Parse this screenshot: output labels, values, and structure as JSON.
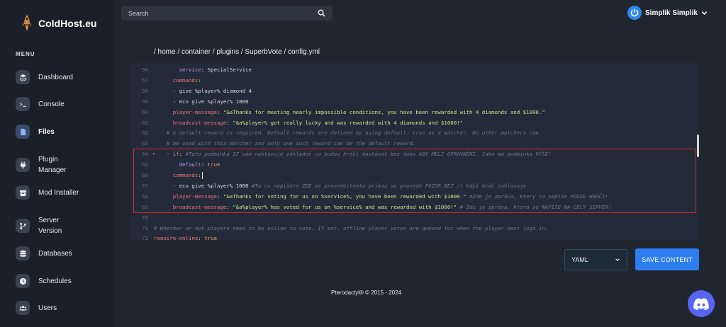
{
  "brand": {
    "name": "ColdHost.eu"
  },
  "sidebar": {
    "menu_heading": "MENU",
    "items": [
      {
        "label": "Dashboard",
        "icon": "layers-icon"
      },
      {
        "label": "Console",
        "icon": "terminal-icon"
      },
      {
        "label": "Files",
        "icon": "file-icon",
        "active": true
      },
      {
        "label": "Plugin\nManager",
        "icon": "plug-icon"
      },
      {
        "label": "Mod Installer",
        "icon": "box-icon"
      },
      {
        "label": "Server\nVersion",
        "icon": "branch-icon"
      },
      {
        "label": "Databases",
        "icon": "database-icon"
      },
      {
        "label": "Schedules",
        "icon": "clock-icon"
      },
      {
        "label": "Users",
        "icon": "users-icon"
      }
    ]
  },
  "search": {
    "placeholder": "Search"
  },
  "user": {
    "name": "Simplik Simplik"
  },
  "breadcrumb": "/ home / container / plugins / SuperbVote / config.yml",
  "editor": {
    "lines": [
      {
        "n": "56",
        "segs": [
          [
            "t",
            "        "
          ],
          [
            "kv",
            "service"
          ],
          [
            "t",
            ": SpecialService"
          ]
        ]
      },
      {
        "n": "57",
        "segs": [
          [
            "t",
            "      "
          ],
          [
            "k",
            "commands"
          ],
          [
            "t",
            ":"
          ]
        ]
      },
      {
        "n": "58",
        "segs": [
          [
            "t",
            "      - give %player% diamond 4"
          ]
        ]
      },
      {
        "n": "59",
        "segs": [
          [
            "t",
            "      - eco give %player% 1000"
          ]
        ]
      },
      {
        "n": "60",
        "segs": [
          [
            "t",
            "      "
          ],
          [
            "k",
            "player-message"
          ],
          [
            "t",
            ": "
          ],
          [
            "s",
            "\"&aThanks for meeting nearly impossible conditions, you have been rewarded with 4 diamonds and $1000.\""
          ]
        ]
      },
      {
        "n": "61",
        "segs": [
          [
            "t",
            "      "
          ],
          [
            "k",
            "broadcast-message"
          ],
          [
            "t",
            ": "
          ],
          [
            "s",
            "\"&a%player% got really lucky and was rewarded with 4 diamonds and $1000!\""
          ]
        ]
      },
      {
        "n": "62",
        "segs": [
          [
            "c",
            "    # A default reward is required. Default rewards are defined by using default: true as a matcher. No other matchers can"
          ]
        ]
      },
      {
        "n": "63",
        "segs": [
          [
            "c",
            "    # be used with this matcher and only one such reward can be the default reward."
          ]
        ]
      },
      {
        "n": "64",
        "fold": true,
        "segs": [
          [
            "t",
            "    - "
          ],
          [
            "k",
            "if"
          ],
          [
            "t",
            ": "
          ],
          [
            "c",
            "#Tato podmínka IF vám nastavuje základně co budou hráči dostávat bez doho ABY MĚLI OPRÁVNĚNÍ. Jako má podmínka VÝŠE!"
          ]
        ]
      },
      {
        "n": "65",
        "segs": [
          [
            "t",
            "        "
          ],
          [
            "kv",
            "default"
          ],
          [
            "t",
            ": "
          ],
          [
            "b",
            "true"
          ]
        ]
      },
      {
        "n": "66",
        "cursor": true,
        "segs": [
          [
            "t",
            "      "
          ],
          [
            "k",
            "commands"
          ],
          [
            "t",
            ":"
          ]
        ]
      },
      {
        "n": "67",
        "segs": [
          [
            "t",
            "      - eco give %player% 1000 "
          ],
          [
            "c",
            "#To co napíšete ZDE se provede(tento příkaz se provede POZOR BEZ /) když hráč zahlasuje"
          ]
        ]
      },
      {
        "n": "68",
        "segs": [
          [
            "t",
            "      "
          ],
          [
            "k",
            "player-message"
          ],
          [
            "t",
            ": "
          ],
          [
            "s",
            "\"&aThanks for voting for us on %service%, you have been rewarded with $1000.\""
          ],
          [
            "c",
            " #Zde je zpráva, který to napíše POUZE HRÁČI!"
          ]
        ]
      },
      {
        "n": "69",
        "segs": [
          [
            "t",
            "      "
          ],
          [
            "k",
            "broadcast-message"
          ],
          [
            "t",
            ": "
          ],
          [
            "s",
            "\"&a%player% has voted for us on %service% and was rewarded with $1000!\""
          ],
          [
            "c",
            " # Zde je zpráva, která se NAPÍŠE NA CELÝ SERVER!"
          ]
        ]
      },
      {
        "n": "70",
        "segs": []
      },
      {
        "n": "71",
        "segs": [
          [
            "c",
            "# Whether or not players need to be online to vote. If set, offline player votes are queued for when the player next logs in."
          ]
        ]
      },
      {
        "n": "72",
        "segs": [
          [
            "k",
            "require-online"
          ],
          [
            "t",
            ": "
          ],
          [
            "b",
            "true"
          ]
        ]
      }
    ]
  },
  "controls": {
    "language": "YAML",
    "save_label": "SAVE CONTENT"
  },
  "footer": {
    "copyright": "Pterodactyl® © 2015 - 2024"
  },
  "colors": {
    "accent": "#2f7ef0",
    "discord": "#5865f2",
    "highlight_border": "#d7262b"
  }
}
